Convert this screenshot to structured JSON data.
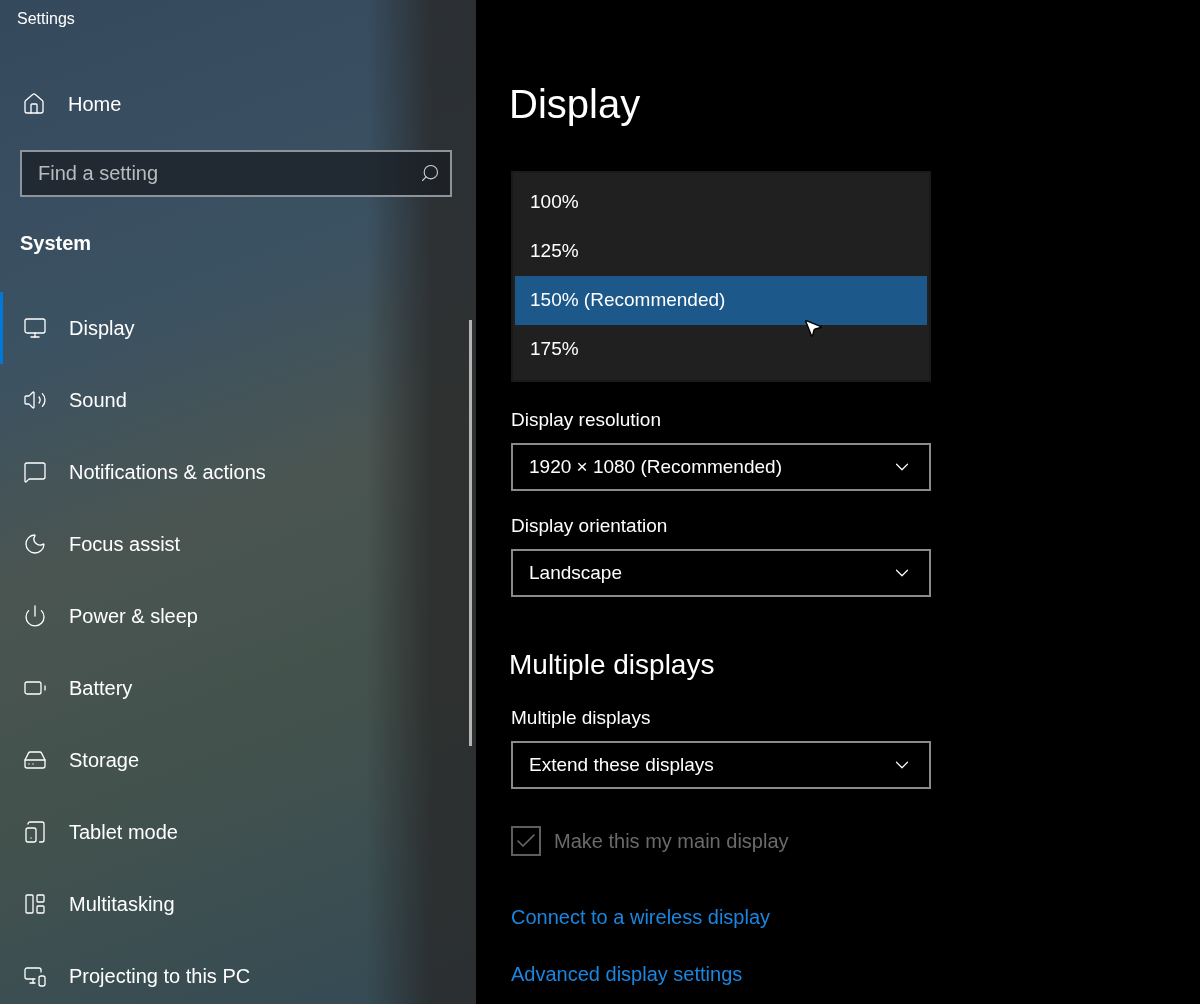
{
  "window": {
    "title": "Settings"
  },
  "sidebar": {
    "home": "Home",
    "search": {
      "placeholder": "Find a setting"
    },
    "section": "System",
    "items": [
      {
        "label": "Display",
        "selected": true
      },
      {
        "label": "Sound",
        "selected": false
      },
      {
        "label": "Notifications & actions",
        "selected": false
      },
      {
        "label": "Focus assist",
        "selected": false
      },
      {
        "label": "Power & sleep",
        "selected": false
      },
      {
        "label": "Battery",
        "selected": false
      },
      {
        "label": "Storage",
        "selected": false
      },
      {
        "label": "Tablet mode",
        "selected": false
      },
      {
        "label": "Multitasking",
        "selected": false
      },
      {
        "label": "Projecting to this PC",
        "selected": false
      }
    ]
  },
  "main": {
    "title": "Display",
    "scale_menu": [
      {
        "label": "100%",
        "selected": false
      },
      {
        "label": "125%",
        "selected": false
      },
      {
        "label": "150% (Recommended)",
        "selected": true
      },
      {
        "label": "175%",
        "selected": false
      }
    ],
    "dropdowns": [
      {
        "label": "Display resolution",
        "value": "1920 × 1080 (Recommended)"
      },
      {
        "label": "Display orientation",
        "value": "Landscape"
      }
    ],
    "multiple": {
      "heading": "Multiple displays",
      "label": "Multiple displays",
      "value": "Extend these displays",
      "checkbox": {
        "label": "Make this my main display",
        "checked": true,
        "disabled": true
      }
    },
    "links": [
      "Connect to a wireless display",
      "Advanced display settings"
    ]
  }
}
